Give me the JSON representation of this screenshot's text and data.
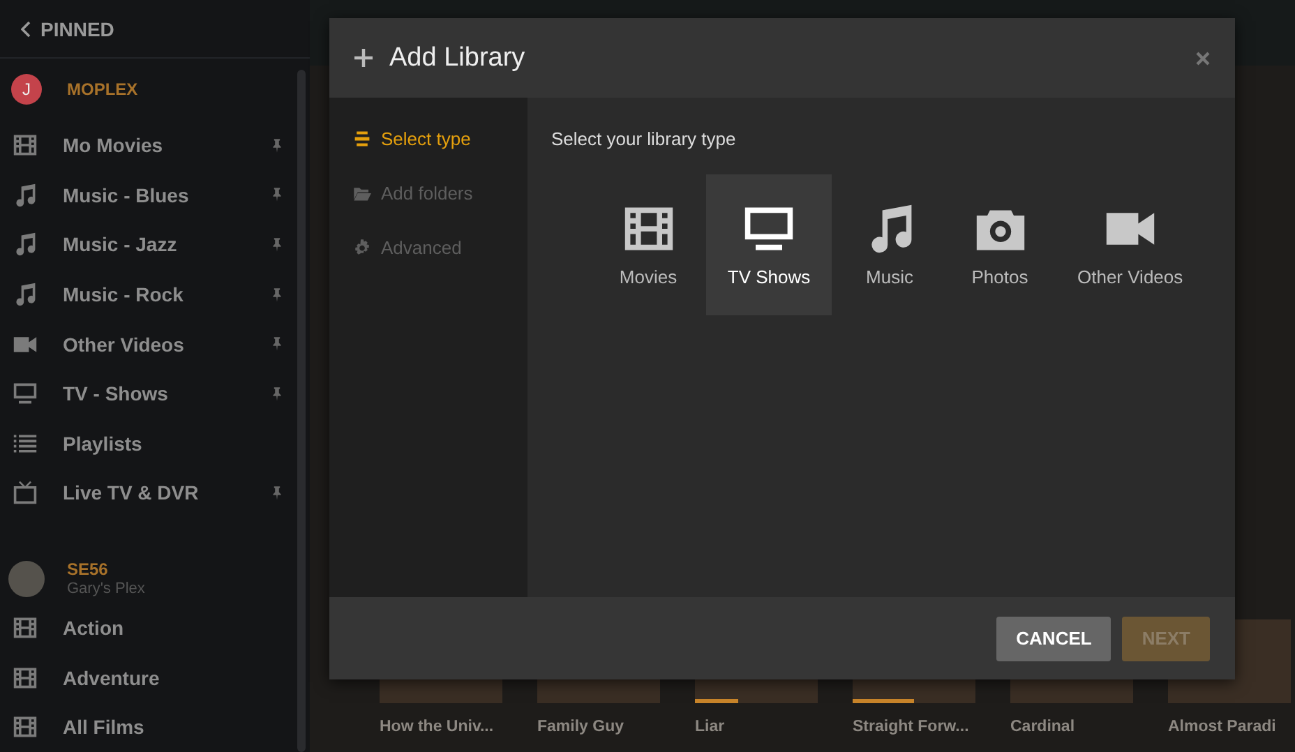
{
  "sidebar": {
    "back": {
      "label": "PINNED"
    },
    "servers": [
      {
        "name": "MOPLEX",
        "avatar": "J",
        "items": [
          {
            "label": "Mo Movies",
            "kind": "film",
            "pinned": true
          },
          {
            "label": "Music - Blues",
            "kind": "music",
            "pinned": true
          },
          {
            "label": "Music - Jazz",
            "kind": "music",
            "pinned": true
          },
          {
            "label": "Music - Rock",
            "kind": "music",
            "pinned": true
          },
          {
            "label": "Other Videos",
            "kind": "video",
            "pinned": true
          },
          {
            "label": "TV - Shows",
            "kind": "tv",
            "pinned": true
          },
          {
            "label": "Playlists",
            "kind": "list",
            "pinned": false
          },
          {
            "label": "Live TV & DVR",
            "kind": "livetv",
            "pinned": true
          }
        ]
      },
      {
        "name": "SE56",
        "subtitle": "Gary's Plex",
        "items": [
          {
            "label": "Action",
            "kind": "film",
            "pinned": false
          },
          {
            "label": "Adventure",
            "kind": "film",
            "pinned": false
          },
          {
            "label": "All Films",
            "kind": "film",
            "pinned": false
          }
        ]
      }
    ]
  },
  "posters": [
    {
      "title": "How the Univ..."
    },
    {
      "title": "Family Guy"
    },
    {
      "title": "Liar",
      "level": 0.35
    },
    {
      "title": "Straight Forw...",
      "level": 0.5
    },
    {
      "title": "Cardinal"
    },
    {
      "title": "Almost Paradi"
    }
  ],
  "dialog": {
    "title": "Add Library",
    "steps": [
      {
        "label": "Select type",
        "kind": "type",
        "selected": true,
        "disabled": false
      },
      {
        "label": "Add folders",
        "kind": "folder",
        "selected": false,
        "disabled": true
      },
      {
        "label": "Advanced",
        "kind": "gear",
        "selected": false,
        "disabled": true
      }
    ],
    "prompt": "Select your library type",
    "types": [
      {
        "label": "Movies",
        "kind": "film",
        "selected": false
      },
      {
        "label": "TV Shows",
        "kind": "tv",
        "selected": true
      },
      {
        "label": "Music",
        "kind": "music",
        "selected": false
      },
      {
        "label": "Photos",
        "kind": "camera",
        "selected": false
      },
      {
        "label": "Other Videos",
        "kind": "video",
        "selected": false
      }
    ],
    "buttons": [
      {
        "label": "CANCEL",
        "kind": "cancel",
        "disabled": false
      },
      {
        "label": "NEXT",
        "kind": "next",
        "disabled": true
      }
    ]
  }
}
